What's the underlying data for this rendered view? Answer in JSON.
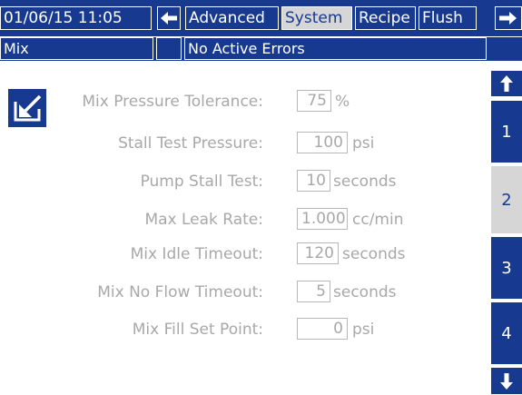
{
  "colors": {
    "primary": "#17398f",
    "active": "#d6d6d6",
    "muted": "#a8a8a8"
  },
  "header": {
    "datetime": "01/06/15 11:05",
    "back_icon": "left-arrow-icon",
    "tabs": [
      {
        "label": "Advanced",
        "active": false
      },
      {
        "label": "System",
        "active": true
      },
      {
        "label": "Recipe",
        "active": false
      },
      {
        "label": "Flush",
        "active": false
      }
    ],
    "forward_icon": "right-arrow-icon"
  },
  "status": {
    "mode": "Mix",
    "errors": "No Active Errors"
  },
  "main": {
    "edit_icon": "edit-icon",
    "fields": [
      {
        "label": "Mix Pressure Tolerance:",
        "value": "75",
        "unit": "%"
      },
      {
        "label": "Stall Test Pressure:",
        "value": "100",
        "unit": "psi"
      },
      {
        "label": "Pump Stall Test:",
        "value": "10",
        "unit": "seconds"
      },
      {
        "label": "Max Leak Rate:",
        "value": "1.000",
        "unit": "cc/min"
      },
      {
        "label": "Mix Idle Timeout:",
        "value": "120",
        "unit": "seconds"
      },
      {
        "label": "Mix No Flow Timeout:",
        "value": "5",
        "unit": "seconds"
      },
      {
        "label": "Mix Fill Set Point:",
        "value": "0",
        "unit": "psi"
      }
    ]
  },
  "side_nav": {
    "up_icon": "up-arrow-icon",
    "pages": [
      "1",
      "2",
      "3",
      "4"
    ],
    "active_page": "2",
    "down_icon": "down-arrow-icon"
  }
}
